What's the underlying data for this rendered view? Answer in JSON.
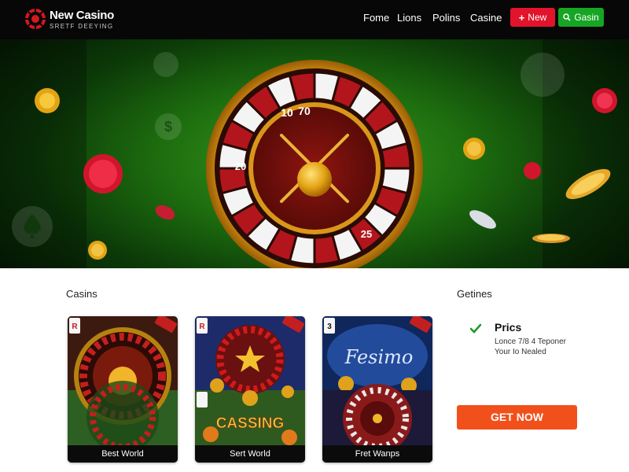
{
  "header": {
    "brand_name": "New Casino",
    "brand_tagline": "SRETF DEEYING",
    "nav": [
      "Fome",
      "Lions",
      "Polins",
      "Casine"
    ],
    "new_button": "New",
    "login_button": "Gasin"
  },
  "hero": {
    "wheel_numbers": [
      "10",
      "70",
      "20",
      "25"
    ]
  },
  "sections": {
    "left_title": "Casins",
    "right_title": "Getines"
  },
  "cards": [
    {
      "label": "Best World",
      "corner": "R"
    },
    {
      "label": "Sert World",
      "corner": "R"
    },
    {
      "label": "Fret Wanps",
      "corner": "3",
      "art_text": "Fesimo"
    }
  ],
  "card_art": {
    "middle_bottom_text": "CASSING"
  },
  "promo": {
    "title": "Prics",
    "line1": "Lonce 7/8 4 Teponer",
    "line2": "Your Io Nealed",
    "cta": "GET NOW"
  },
  "colors": {
    "header_bg": "#070707",
    "red_button": "#e2142b",
    "green_button": "#17a524",
    "cta": "#f2501b",
    "hero_green": "#2f8a18",
    "gold": "#d99a10"
  }
}
